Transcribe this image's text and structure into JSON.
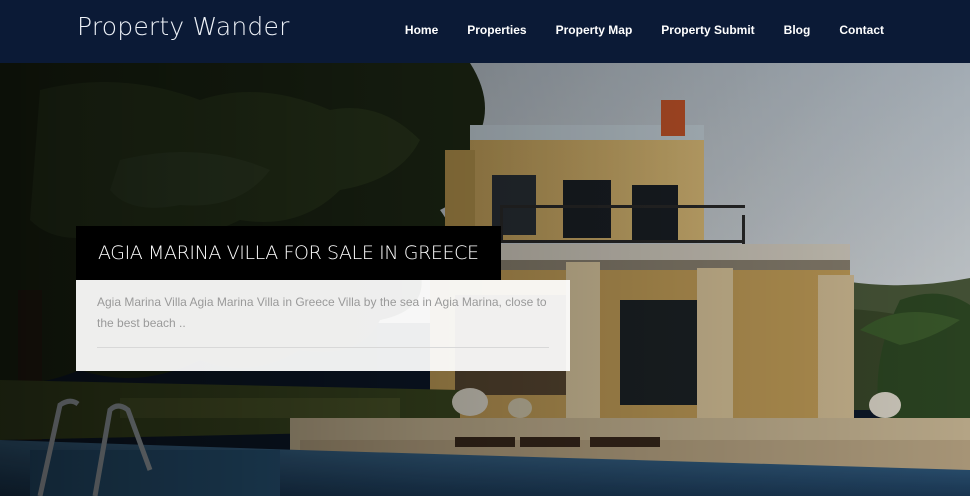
{
  "brand": {
    "name": "Property Wander"
  },
  "nav": {
    "items": [
      {
        "label": "Home"
      },
      {
        "label": "Properties"
      },
      {
        "label": "Property Map"
      },
      {
        "label": "Property Submit"
      },
      {
        "label": "Blog"
      },
      {
        "label": "Contact"
      }
    ]
  },
  "slide": {
    "title": "AGIA MARINA VILLA FOR SALE IN GREECE",
    "excerpt": "Agia Marina Villa Agia Marina Villa in Greece Villa by the sea in Agia Marina, close to the best beach .."
  },
  "colors": {
    "header_bg": "#0b1a36",
    "caption_title_bg": "#000000",
    "caption_body_bg": "#ffffff"
  }
}
